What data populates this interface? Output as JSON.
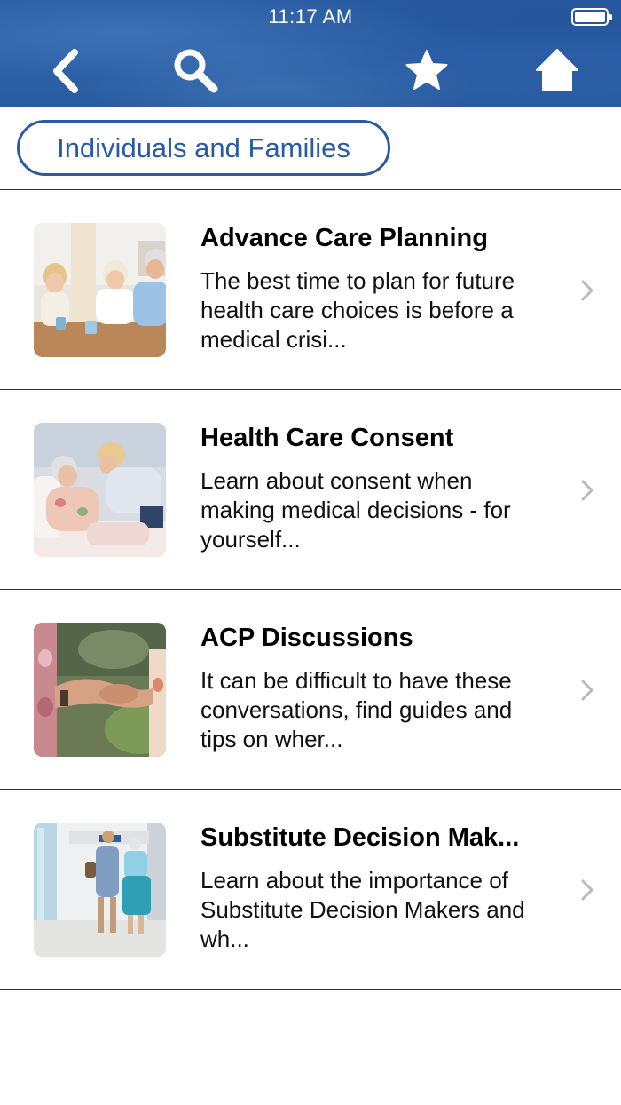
{
  "status_bar": {
    "time": "11:17 AM"
  },
  "nav": {
    "back_icon": "chevron-left-icon",
    "search_icon": "search-icon",
    "favorites_icon": "star-icon",
    "home_icon": "home-icon"
  },
  "category": {
    "label": "Individuals and Families"
  },
  "items": [
    {
      "title": "Advance Care Planning",
      "description": "The best time to plan for future health care choices is before a medical crisi..."
    },
    {
      "title": "Health Care Consent",
      "description": "Learn about consent when making medical decisions - for yourself..."
    },
    {
      "title": "ACP Discussions",
      "description": "It can be difficult to have these conversations, find guides and tips on wher..."
    },
    {
      "title": "Substitute Decision Mak...",
      "description": "Learn about the importance of Substitute Decision Makers and wh..."
    }
  ],
  "colors": {
    "header_blue": "#2b5aa4",
    "accent": "#2b5aa4",
    "divider": "#333333",
    "chevron": "#b9b9be"
  }
}
